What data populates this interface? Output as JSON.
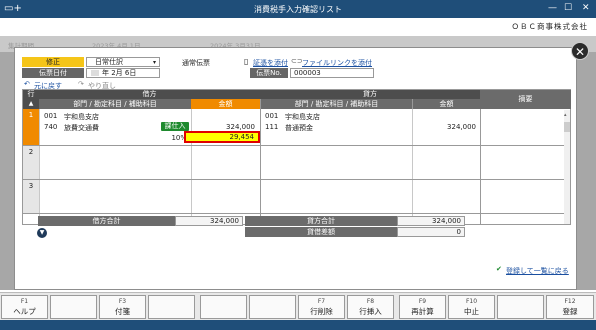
{
  "window": {
    "title": "消費税手入力確認リスト",
    "company": "ＯＢＣ商事株式会社",
    "minimize": "—",
    "maximize": "☐",
    "close": "✕"
  },
  "background": {
    "label": "集計期間",
    "from": "2023年 4月 1日",
    "to": "2024年 3月31日"
  },
  "voucher": {
    "mode_label": "修正",
    "kind": "日常仕訳",
    "type_label": "通常伝票",
    "date_label": "伝票日付",
    "date_value": "年  2月  6日",
    "no_label": "伝票No.",
    "no_value": "000003",
    "attach_voucher": "証憑を添付",
    "attach_file": "ファイルリンクを添付",
    "undo": "元に戻す",
    "redo": "やり直し"
  },
  "table": {
    "row_col": "行",
    "debit_header": "借方",
    "credit_header": "貸方",
    "memo_header": "摘要",
    "account_header": "部門 / 勘定科目 / 補助科目",
    "amount_header": "金額",
    "rows": [
      {
        "num": "1",
        "debit_dept_code": "001",
        "debit_dept": "宇和島支店",
        "debit_acct_code": "740",
        "debit_acct": "旅費交通費",
        "tax_badge": "課仕入",
        "debit_amount": "324,000",
        "tax_rate": "10%",
        "tax_amount": "29,454",
        "credit_dept_code": "001",
        "credit_dept": "宇和島支店",
        "credit_acct_code": "111",
        "credit_acct": "普通預金",
        "credit_amount": "324,000"
      },
      {
        "num": "2"
      },
      {
        "num": "3"
      }
    ]
  },
  "totals": {
    "debit_total_label": "借方合計",
    "debit_total": "324,000",
    "credit_total_label": "貸方合計",
    "credit_total": "324,000",
    "diff_label": "貸借差額",
    "diff": "0"
  },
  "footer_link": "登録して一覧に戻る",
  "fkeys": [
    {
      "key": "F1",
      "name": "ヘルプ"
    },
    {
      "key": "",
      "name": ""
    },
    {
      "key": "F3",
      "name": "付箋"
    },
    {
      "key": "",
      "name": ""
    },
    {
      "key": "",
      "name": ""
    },
    {
      "key": "",
      "name": ""
    },
    {
      "key": "F7",
      "name": "行削除"
    },
    {
      "key": "F8",
      "name": "行挿入"
    },
    {
      "key": "F9",
      "name": "再計算"
    },
    {
      "key": "F10",
      "name": "中止"
    },
    {
      "key": "",
      "name": ""
    },
    {
      "key": "F12",
      "name": "登録"
    }
  ],
  "colors": {
    "titlebar": "#1f4e79",
    "accent_orange": "#f08a00",
    "mode_yellow": "#f5c518",
    "badge_green": "#1e8a2e",
    "highlight_red": "#e00000",
    "highlight_yellow": "#ffff00"
  }
}
